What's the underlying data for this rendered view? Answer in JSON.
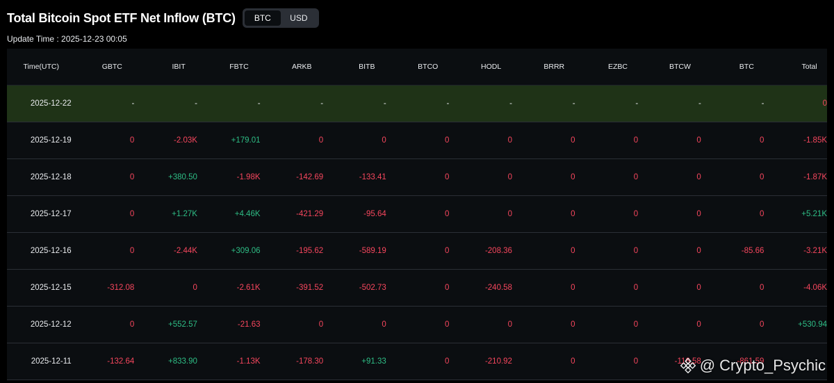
{
  "title": "Total Bitcoin Spot ETF Net Inflow (BTC)",
  "toggle": {
    "options": [
      "BTC",
      "USD"
    ],
    "active": "BTC"
  },
  "update_time": "Update Time : 2025-12-23 00:05",
  "table": {
    "columns": [
      "Time(UTC)",
      "GBTC",
      "IBIT",
      "FBTC",
      "ARKB",
      "BITB",
      "BTCO",
      "HODL",
      "BRRR",
      "EZBC",
      "BTCW",
      "BTC",
      "Total"
    ],
    "rows": [
      {
        "highlight": true,
        "cells": [
          "2025-12-22",
          "-",
          "-",
          "-",
          "-",
          "-",
          "-",
          "-",
          "-",
          "-",
          "-",
          "-",
          "0"
        ]
      },
      {
        "highlight": false,
        "cells": [
          "2025-12-19",
          "0",
          "-2.03K",
          "+179.01",
          "0",
          "0",
          "0",
          "0",
          "0",
          "0",
          "0",
          "0",
          "-1.85K"
        ]
      },
      {
        "highlight": false,
        "cells": [
          "2025-12-18",
          "0",
          "+380.50",
          "-1.98K",
          "-142.69",
          "-133.41",
          "0",
          "0",
          "0",
          "0",
          "0",
          "0",
          "-1.87K"
        ]
      },
      {
        "highlight": false,
        "cells": [
          "2025-12-17",
          "0",
          "+1.27K",
          "+4.46K",
          "-421.29",
          "-95.64",
          "0",
          "0",
          "0",
          "0",
          "0",
          "0",
          "+5.21K"
        ]
      },
      {
        "highlight": false,
        "cells": [
          "2025-12-16",
          "0",
          "-2.44K",
          "+309.06",
          "-195.62",
          "-589.19",
          "0",
          "-208.36",
          "0",
          "0",
          "0",
          "-85.66",
          "-3.21K"
        ]
      },
      {
        "highlight": false,
        "cells": [
          "2025-12-15",
          "-312.08",
          "0",
          "-2.61K",
          "-391.52",
          "-502.73",
          "0",
          "-240.58",
          "0",
          "0",
          "0",
          "0",
          "-4.06K"
        ]
      },
      {
        "highlight": false,
        "cells": [
          "2025-12-12",
          "0",
          "+552.57",
          "-21.63",
          "0",
          "0",
          "0",
          "0",
          "0",
          "0",
          "0",
          "0",
          "+530.94"
        ]
      },
      {
        "highlight": false,
        "cells": [
          "2025-12-11",
          "-132.64",
          "+833.90",
          "-1.13K",
          "-178.30",
          "+91.33",
          "0",
          "-210.92",
          "0",
          "0",
          "-116.58",
          "-861.59",
          ""
        ]
      }
    ]
  },
  "watermark": {
    "text": "@ Crypto_Psychic",
    "icon": "binance-logo-icon"
  },
  "colors": {
    "positive": "#2ebd85",
    "negative": "#f6465d",
    "highlight_row": "#1f3317",
    "background": "#000000",
    "table_bg": "#0b0e11"
  }
}
